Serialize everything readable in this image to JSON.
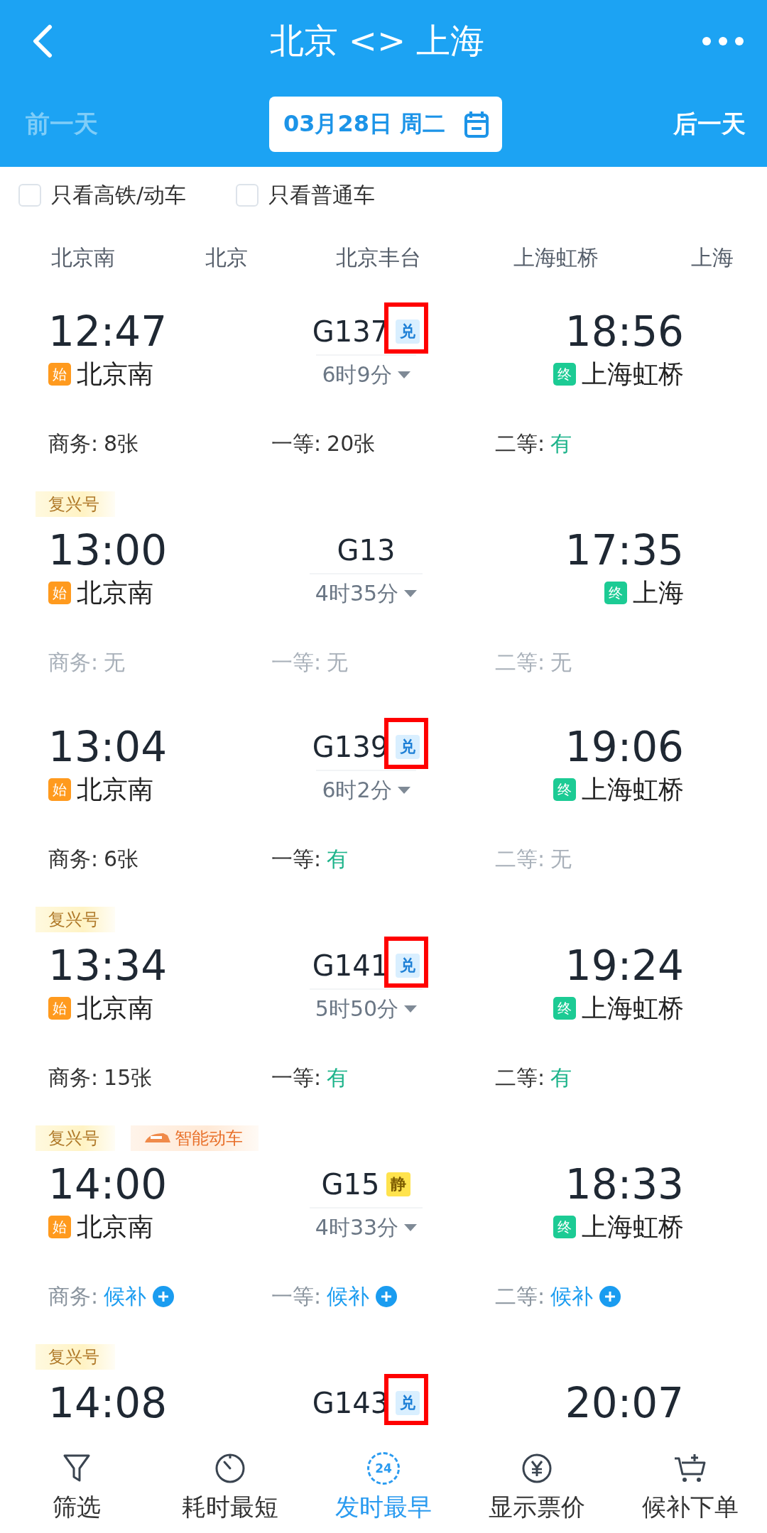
{
  "header": {
    "title": "北京 <> 上海",
    "prev_day": {
      "label": "前一天",
      "disabled": true
    },
    "date": "03月28日 周二",
    "next_day": {
      "label": "后一天",
      "disabled": false
    }
  },
  "filters": [
    {
      "label": "只看高铁/动车",
      "checked": false
    },
    {
      "label": "只看普通车",
      "checked": false
    }
  ],
  "stations": [
    "北京南",
    "北京",
    "北京丰台",
    "上海虹桥",
    "上海"
  ],
  "trains": [
    {
      "depart": "12:47",
      "number": "G137",
      "badge": {
        "kind": "exchange",
        "text": "兑"
      },
      "highlighted": true,
      "arrive": "18:56",
      "from_mark": "始",
      "from": "北京南",
      "duration": "6时9分",
      "to_mark": "终",
      "to": "上海虹桥",
      "seats": [
        {
          "label": "商务:",
          "value": "8张",
          "kind": "count"
        },
        {
          "label": "一等:",
          "value": "20张",
          "kind": "count"
        },
        {
          "label": "二等:",
          "value": "有",
          "kind": "available"
        }
      ]
    },
    {
      "tags": [
        {
          "kind": "plain",
          "text": "复兴号"
        }
      ],
      "depart": "13:00",
      "number": "G13",
      "highlighted": false,
      "arrive": "17:35",
      "from_mark": "始",
      "from": "北京南",
      "duration": "4时35分",
      "to_mark": "终",
      "to": "上海",
      "seats": [
        {
          "label": "商务:",
          "value": "无",
          "kind": "none"
        },
        {
          "label": "一等:",
          "value": "无",
          "kind": "none"
        },
        {
          "label": "二等:",
          "value": "无",
          "kind": "none"
        }
      ]
    },
    {
      "depart": "13:04",
      "number": "G139",
      "badge": {
        "kind": "exchange",
        "text": "兑"
      },
      "highlighted": true,
      "arrive": "19:06",
      "from_mark": "始",
      "from": "北京南",
      "duration": "6时2分",
      "to_mark": "终",
      "to": "上海虹桥",
      "seats": [
        {
          "label": "商务:",
          "value": "6张",
          "kind": "count"
        },
        {
          "label": "一等:",
          "value": "有",
          "kind": "available"
        },
        {
          "label": "二等:",
          "value": "无",
          "kind": "none"
        }
      ]
    },
    {
      "tags": [
        {
          "kind": "plain",
          "text": "复兴号"
        }
      ],
      "depart": "13:34",
      "number": "G141",
      "badge": {
        "kind": "exchange",
        "text": "兑"
      },
      "highlighted": true,
      "arrive": "19:24",
      "from_mark": "始",
      "from": "北京南",
      "duration": "5时50分",
      "to_mark": "终",
      "to": "上海虹桥",
      "seats": [
        {
          "label": "商务:",
          "value": "15张",
          "kind": "count"
        },
        {
          "label": "一等:",
          "value": "有",
          "kind": "available"
        },
        {
          "label": "二等:",
          "value": "有",
          "kind": "available"
        }
      ]
    },
    {
      "tags": [
        {
          "kind": "plain",
          "text": "复兴号"
        },
        {
          "kind": "smart",
          "text": "智能动车"
        }
      ],
      "depart": "14:00",
      "number": "G15",
      "badge": {
        "kind": "quiet",
        "text": "静"
      },
      "highlighted": false,
      "arrive": "18:33",
      "from_mark": "始",
      "from": "北京南",
      "duration": "4时33分",
      "to_mark": "终",
      "to": "上海虹桥",
      "seats": [
        {
          "label": "商务:",
          "value": "候补",
          "kind": "waitlist"
        },
        {
          "label": "一等:",
          "value": "候补",
          "kind": "waitlist"
        },
        {
          "label": "二等:",
          "value": "候补",
          "kind": "waitlist"
        }
      ]
    },
    {
      "tags": [
        {
          "kind": "plain",
          "text": "复兴号"
        }
      ],
      "depart": "14:08",
      "number": "G143",
      "badge": {
        "kind": "exchange",
        "text": "兑"
      },
      "highlighted": true,
      "arrive": "20:07"
    }
  ],
  "tabbar": [
    {
      "label": "筛选",
      "selected": false
    },
    {
      "label": "耗时最短",
      "selected": false
    },
    {
      "label": "发时最早",
      "icon_text": "24",
      "selected": true
    },
    {
      "label": "显示票价",
      "selected": false
    },
    {
      "label": "候补下单",
      "selected": false
    }
  ]
}
